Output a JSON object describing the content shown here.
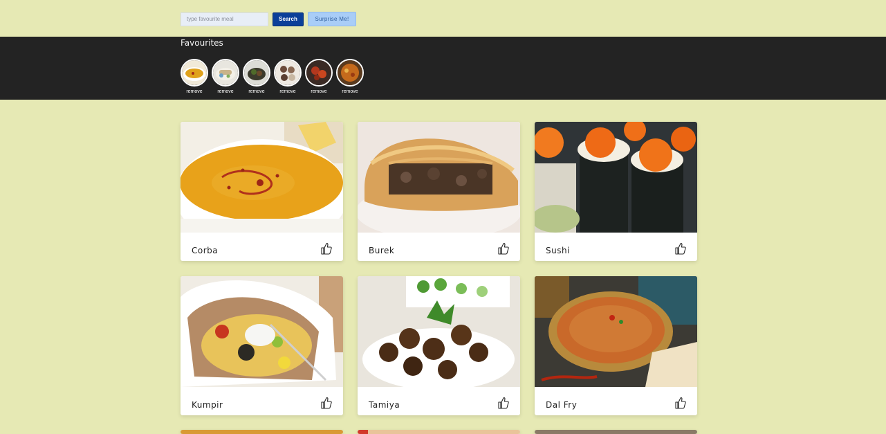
{
  "search": {
    "placeholder": "type favourite meal",
    "value": "",
    "search_label": "Search",
    "surprise_label": "Surprise Me!"
  },
  "favourites": {
    "title": "Favourites",
    "items": [
      {
        "remove_label": "remove",
        "image": "lentil-soup"
      },
      {
        "remove_label": "remove",
        "image": "wrap"
      },
      {
        "remove_label": "remove",
        "image": "grilled-dish"
      },
      {
        "remove_label": "remove",
        "image": "dumplings"
      },
      {
        "remove_label": "remove",
        "image": "spicy-chicken"
      },
      {
        "remove_label": "remove",
        "image": "curry"
      }
    ]
  },
  "meals": [
    {
      "name": "Corba",
      "icon": "thumbs-up-icon"
    },
    {
      "name": "Burek",
      "icon": "thumbs-up-icon"
    },
    {
      "name": "Sushi",
      "icon": "thumbs-up-icon"
    },
    {
      "name": "Kumpir",
      "icon": "thumbs-up-icon"
    },
    {
      "name": "Tamiya",
      "icon": "thumbs-up-icon"
    },
    {
      "name": "Dal Fry",
      "icon": "thumbs-up-icon"
    }
  ],
  "colors": {
    "background": "#e6e9b4",
    "fav_bar": "#232323",
    "search_button": "#0b3f99",
    "surprise_button": "#a9cdf7"
  }
}
